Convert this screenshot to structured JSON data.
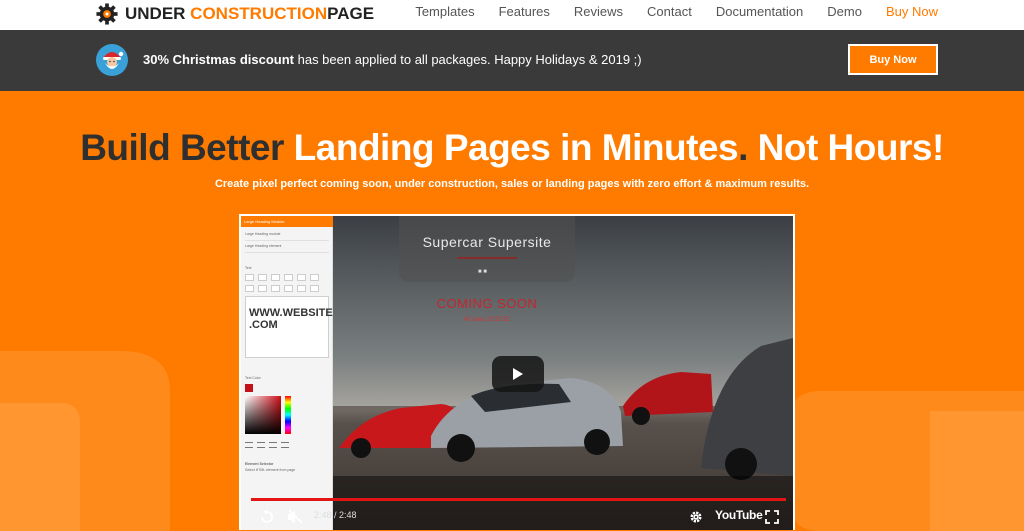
{
  "nav": {
    "logo": {
      "part1": "UNDER ",
      "part2": "CONSTRUCTION",
      "part3": "PAGE"
    },
    "links": [
      {
        "label": "Templates"
      },
      {
        "label": "Features"
      },
      {
        "label": "Reviews"
      },
      {
        "label": "Contact"
      },
      {
        "label": "Documentation"
      },
      {
        "label": "Demo"
      },
      {
        "label": "Buy Now",
        "accent": true
      }
    ]
  },
  "promo": {
    "bold": "30% Christmas discount",
    "rest": " has been applied to all packages. Happy Holidays & 2019 ;)",
    "button": "Buy Now"
  },
  "hero": {
    "title_parts": [
      "Build Better ",
      "Landing Pages in Minutes",
      ". ",
      "Not Hours!"
    ],
    "subtitle": "Create pixel perfect coming soon, under construction, sales or landing pages with zero effort & maximum results."
  },
  "video": {
    "editor": {
      "header": "Large Heading Module",
      "field1": "Large Heading module",
      "field2": "Large Heading element",
      "text_label": "Text",
      "text_value_line1": "WWW.WEBSITE",
      "text_value_line2": ".COM",
      "color_label": "Text Color",
      "selector_label": "Element Selector",
      "selector_hint": "Select HTML element from page"
    },
    "scene": {
      "title": "Supercar Supersite",
      "coming_soon": "COMING SOON",
      "countdown": "45 days 23:25:52"
    },
    "player": {
      "time": "2:48 / 2:48",
      "youtube": "YouTube",
      "progress": 1.0
    }
  },
  "colors": {
    "accent": "#ff7b00",
    "dark_bar": "#3a3a3a",
    "title_dark": "#2f2f2f",
    "progress_red": "#e31414"
  }
}
